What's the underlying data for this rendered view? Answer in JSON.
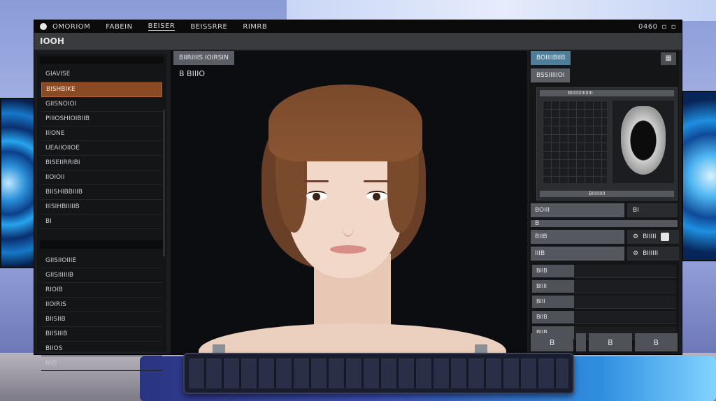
{
  "menubar": {
    "items": [
      "OMORIOM",
      "FABEIN",
      "BEISER",
      "BEISSRRE",
      "RIMRB"
    ],
    "active_index": 2,
    "status": "0460"
  },
  "titlebar": {
    "title": "IOOH"
  },
  "sidebar": {
    "group_1": [
      "GIAVISE",
      "BISHBIKE",
      "GIISNOIOI",
      "PIIIOSHIOIBIIB",
      "IIIONE",
      "UEAIIOIIOE",
      "BISEIIRRIBI",
      "IIOIOII",
      "BIISHIBBIIIB",
      "IIISIHBIIIIIB",
      "BI"
    ],
    "active_index": 1,
    "group_2": [
      "GIISIIOIIIE",
      "GIISIIIIIIB",
      "RIOIB",
      "IIOIRIS",
      "BIISIIB",
      "BIISIIIB",
      "BIIOS",
      "IIIIS"
    ]
  },
  "viewport": {
    "tab": "BIIRIIIIS IOIRSIN",
    "label": "B BIIIO"
  },
  "right_panel": {
    "tab": "BOIIIIBIIB",
    "corner_icon": "panel-icon",
    "subtab": "BSSIIIIIOI",
    "mesh_header": "BIIIIIIIIIIIIIII",
    "mesh_footer": "BIIIIIIIII",
    "row_1": {
      "label": "BOIII",
      "value": "BI"
    },
    "row_2": {
      "label": "B"
    },
    "row_3": {
      "label": "BIIB",
      "value": "BIIIII"
    },
    "row_4": {
      "label": "IIIB",
      "value": "BIIIIII"
    },
    "small_rows": [
      "BIIB",
      "BIIII",
      "BIII",
      "BIIB",
      "BIIB"
    ],
    "bottom_buttons": [
      "B",
      "B",
      "B"
    ]
  },
  "colors": {
    "accent_active": "#8a4a24",
    "tab_blue": "#4f7e9a"
  }
}
